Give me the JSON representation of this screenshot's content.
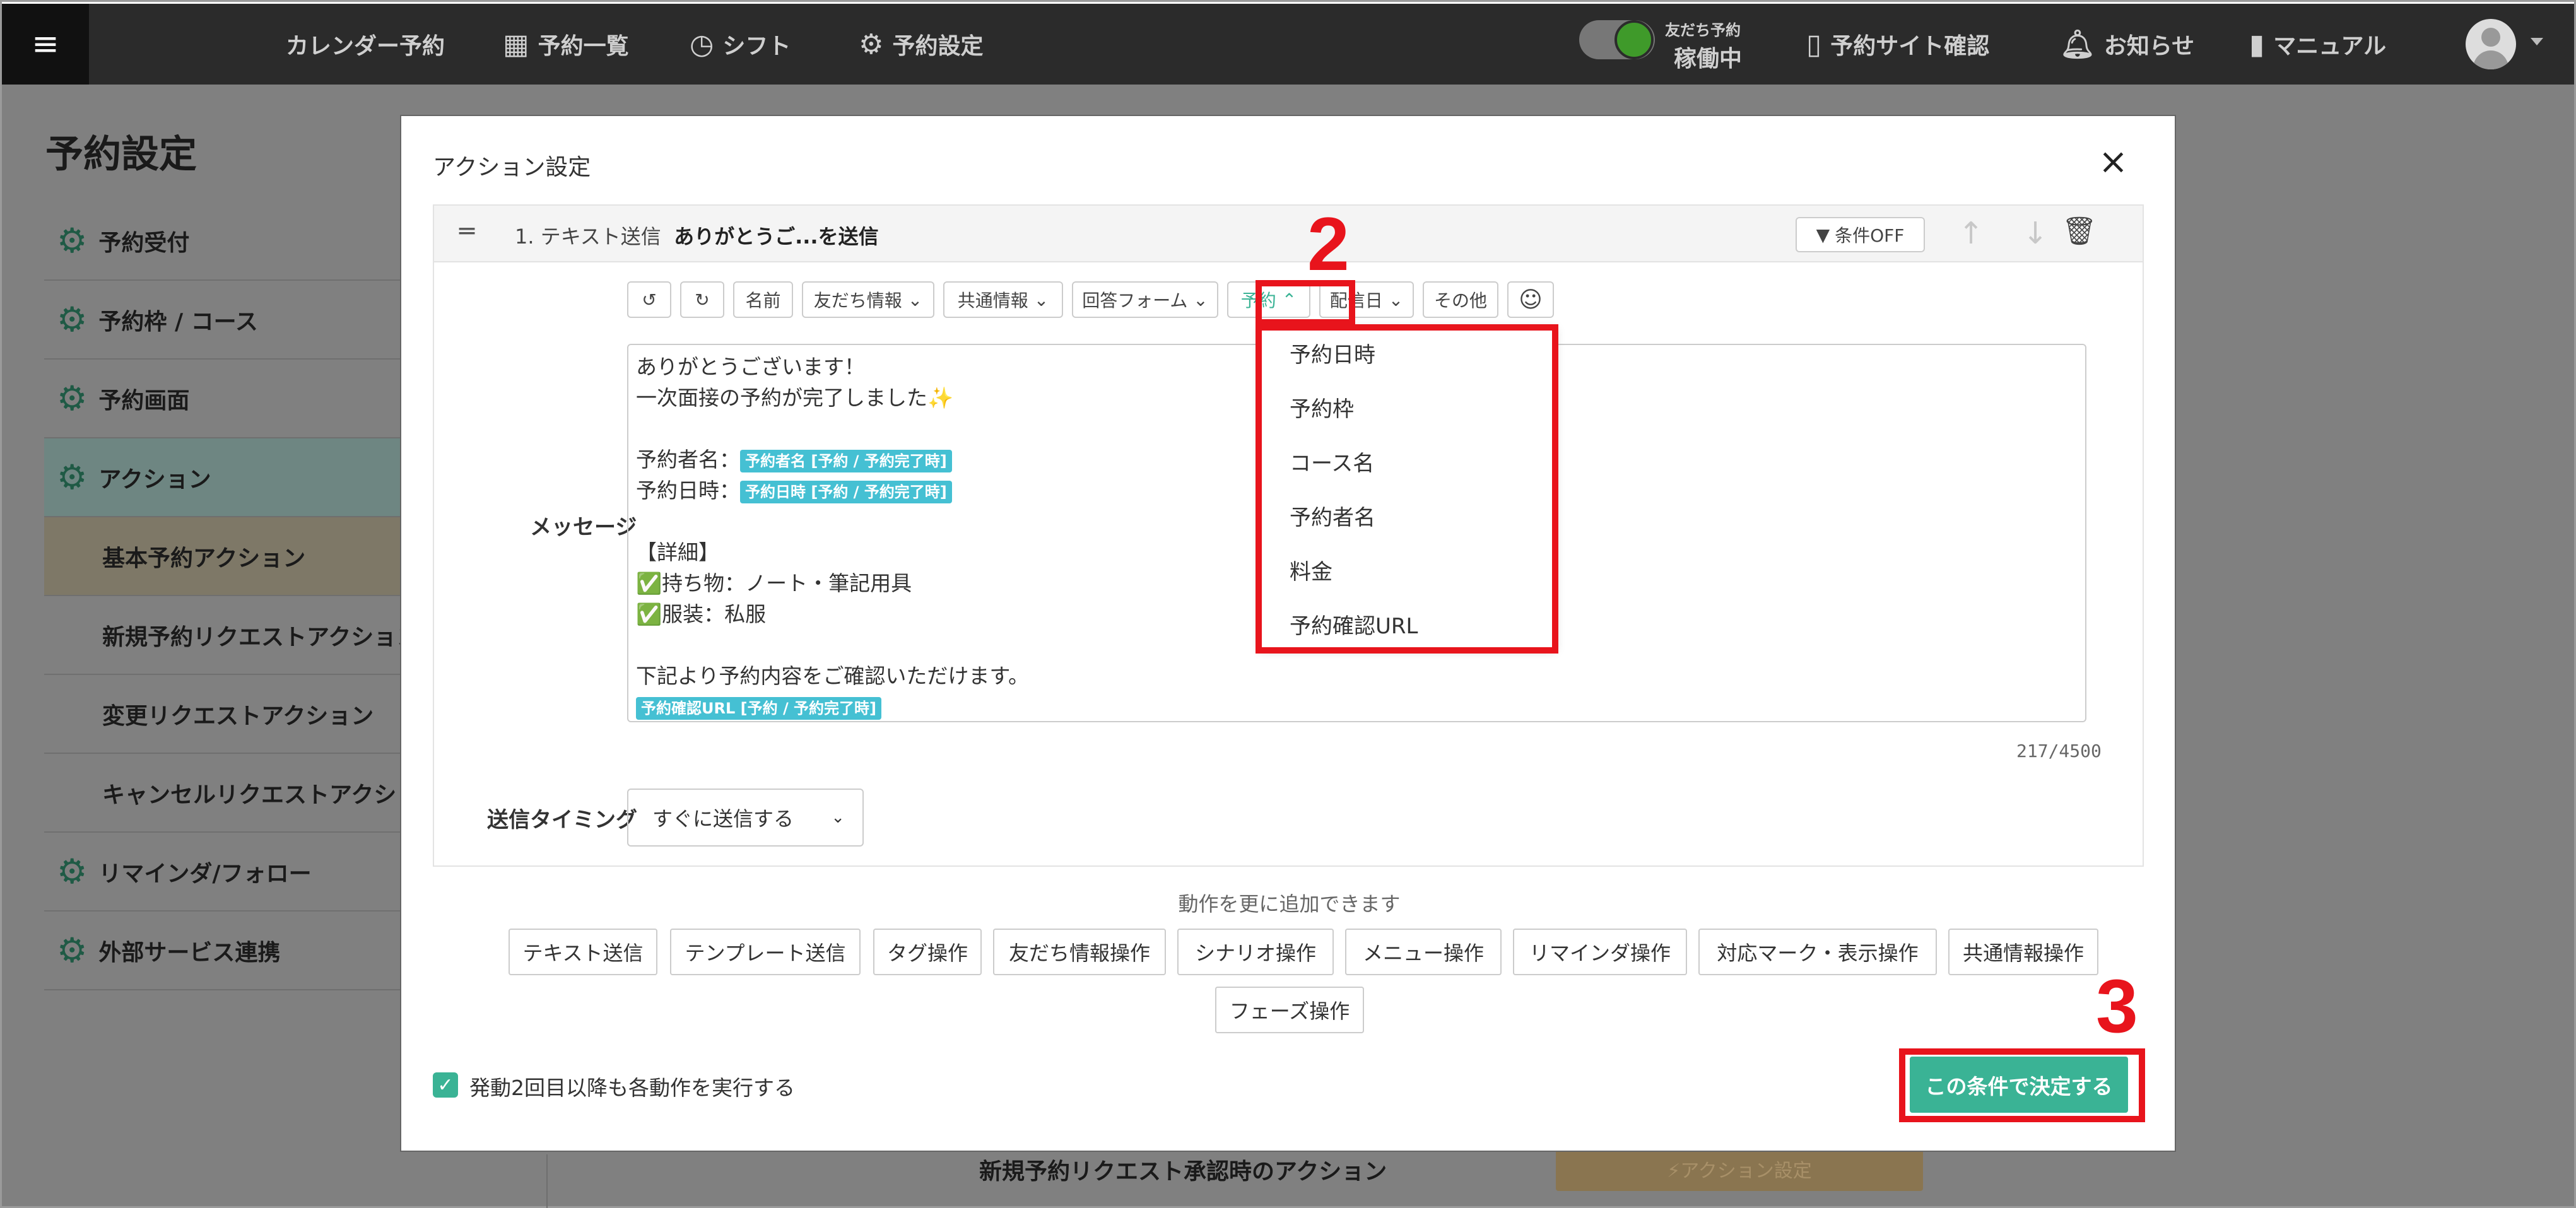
{
  "topbar": {
    "menu_icon": "hamburger-icon",
    "nav": [
      {
        "label": "カレンダー予約",
        "icon": ""
      },
      {
        "label": "予約一覧",
        "icon": "calendar-icon"
      },
      {
        "label": "シフト",
        "icon": "clock-icon"
      },
      {
        "label": "予約設定",
        "icon": "gear-icon"
      }
    ],
    "toggle_small": "友だち予約",
    "toggle_status": "稼働中",
    "site_check": "予約サイト確認",
    "notice": "お知らせ",
    "manual": "マニュアル"
  },
  "page": {
    "title": "予約設定",
    "sidebar": [
      {
        "label": "予約受付",
        "icon": "gear-icon"
      },
      {
        "label": "予約枠 / コース",
        "icon": "gear-icon"
      },
      {
        "label": "予約画面",
        "icon": "gear-icon"
      },
      {
        "label": "アクション",
        "icon": "gear-icon"
      },
      {
        "label": "基本予約アクション"
      },
      {
        "label": "新規予約リクエストアクション"
      },
      {
        "label": "変更リクエストアクション"
      },
      {
        "label": "キャンセルリクエストアクション"
      },
      {
        "label": "リマインダ/フォロー",
        "icon": "gear-icon"
      },
      {
        "label": "外部サービス連携",
        "icon": "gear-icon"
      }
    ],
    "bottom_text": "新規予約リクエスト承認時のアクション",
    "bottom_button": "⚡アクション設定"
  },
  "modal": {
    "title": "アクション設定",
    "card": {
      "index_label": "1. テキスト送信",
      "name": "ありがとうご...を送信",
      "condition_button": "条件OFF"
    },
    "toolbar": {
      "undo": "↺",
      "redo": "↻",
      "name": "名前",
      "friend_info": "友だち情報",
      "common_info": "共通情報",
      "answer_form": "回答フォーム",
      "reservation": "予約",
      "delivery_date": "配信日",
      "other": "その他"
    },
    "message_label": "メッセージ",
    "message": {
      "line1": "ありがとうございます！",
      "line2": "一次面接の予約が完了しました✨",
      "line3_prefix": "予約者名：",
      "line3_chip": "予約者名 [予約 / 予約完了時]",
      "line4_prefix": "予約日時：",
      "line4_chip": "予約日時 [予約 / 予約完了時]",
      "line5": "【詳細】",
      "line6": "✅持ち物：ノート・筆記用具",
      "line7": "✅服装：私服",
      "line8": "下記より予約内容をご確認いただけます。",
      "line9_chip": "予約確認URL [予約 / 予約完了時]"
    },
    "counter": "217/4500",
    "timing_label": "送信タイミング",
    "timing_value": "すぐに送信する",
    "add_text": "動作を更に追加できます",
    "add_buttons": [
      "テキスト送信",
      "テンプレート送信",
      "タグ操作",
      "友だち情報操作",
      "シナリオ操作",
      "メニュー操作",
      "リマインダ操作",
      "対応マーク・表示操作",
      "共通情報操作",
      "フェーズ操作"
    ],
    "checkbox_label": "発動2回目以降も各動作を実行する",
    "submit": "この条件で決定する"
  },
  "dropdown": {
    "items": [
      "予約日時",
      "予約枠",
      "コース名",
      "予約者名",
      "料金",
      "予約確認URL"
    ]
  },
  "annotations": {
    "step2": "2",
    "step3": "3"
  },
  "colors": {
    "accent": "#3ab395",
    "annotation": "#e8141c",
    "chip": "#45c0d3",
    "topbar": "#2b2b2b"
  }
}
